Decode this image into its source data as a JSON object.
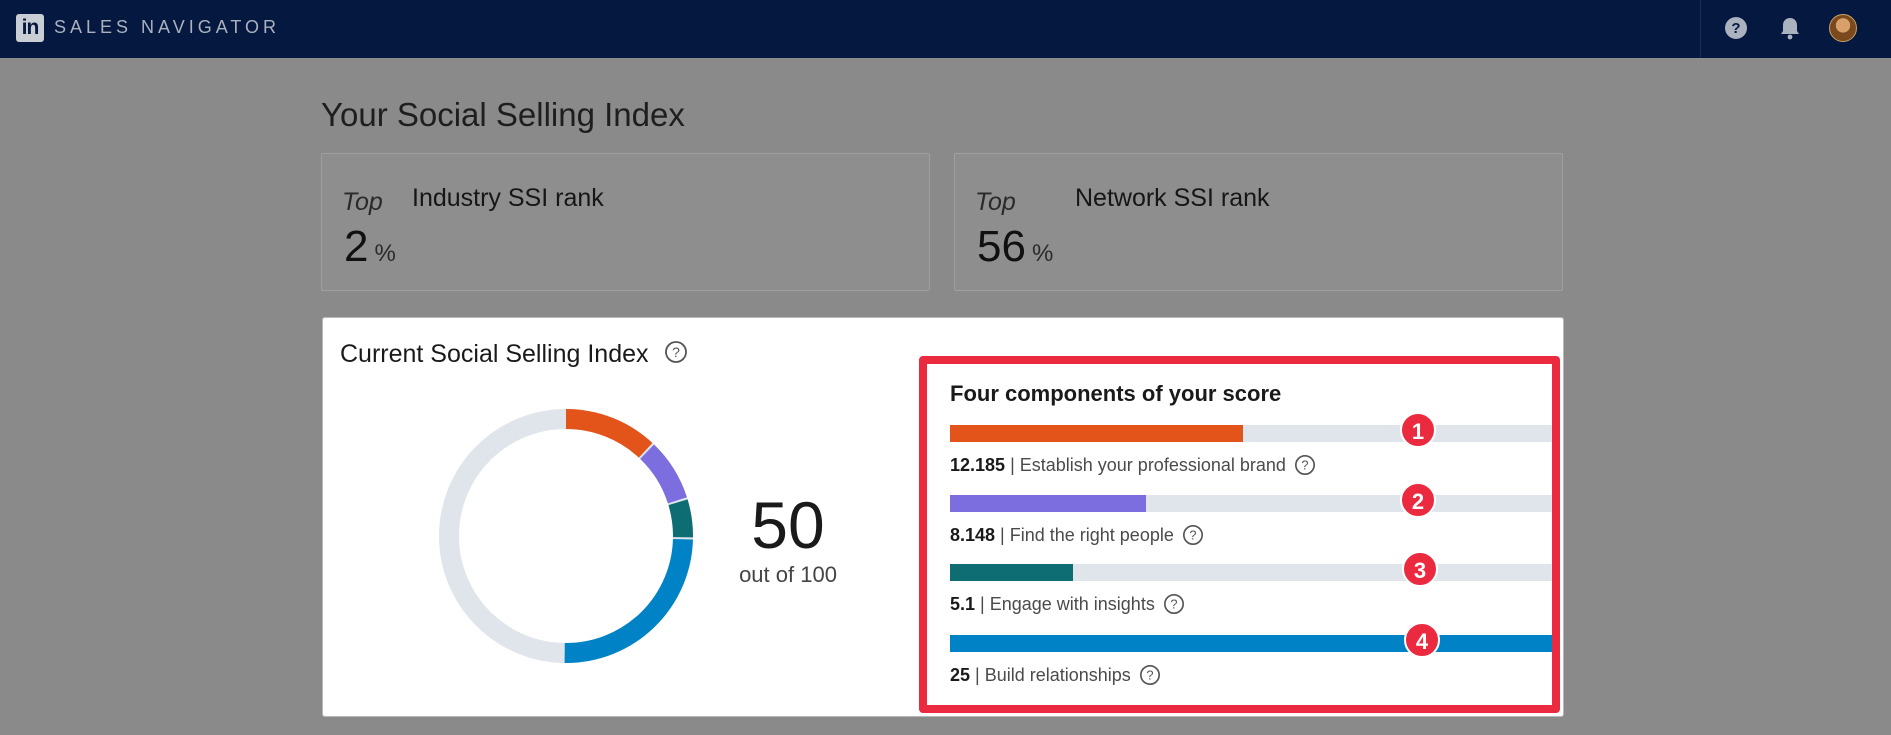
{
  "topbar": {
    "logo_text": "in",
    "brand": "SALES NAVIGATOR",
    "icons": [
      "help-icon",
      "bell-icon",
      "avatar"
    ]
  },
  "page": {
    "title": "Your Social Selling Index"
  },
  "ranks": [
    {
      "prefix": "Top",
      "title": "Industry SSI rank",
      "value": "2",
      "unit": "%"
    },
    {
      "prefix": "Top",
      "title": "Network SSI rank",
      "value": "56",
      "unit": "%"
    }
  ],
  "ssi": {
    "title": "Current Social Selling Index",
    "score": "50",
    "score_sub": "out of 100",
    "max": 100
  },
  "components": {
    "title": "Four components of your score",
    "max_each": 25,
    "items": [
      {
        "badge": "1",
        "value": "12.185",
        "label": "Establish your professional brand",
        "fraction": 0.4874,
        "color": "#e2541a"
      },
      {
        "badge": "2",
        "value": "8.148",
        "label": "Find the right people",
        "fraction": 0.3259,
        "color": "#7d6ee0"
      },
      {
        "badge": "3",
        "value": "5.1",
        "label": "Engage with insights",
        "fraction": 0.204,
        "color": "#0e6c73"
      },
      {
        "badge": "4",
        "value": "25",
        "label": "Build relationships",
        "fraction": 1.0,
        "color": "#0082c6"
      }
    ]
  },
  "colors": {
    "track": "#e0e5ec",
    "annotation": "#ec2a3f",
    "nav_bg": "#05183f"
  }
}
